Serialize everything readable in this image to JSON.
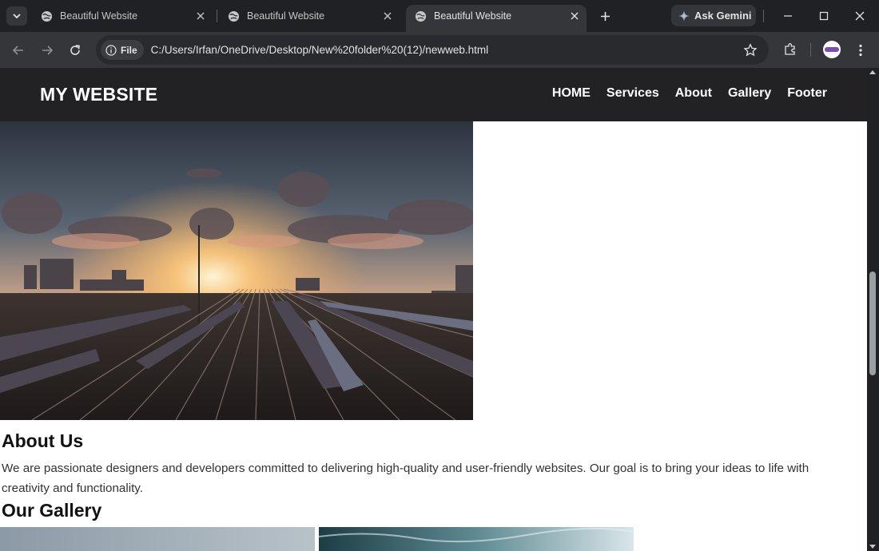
{
  "browser": {
    "tabs": [
      {
        "title": "Beautiful Website",
        "favicon": "globe-icon"
      },
      {
        "title": "Beautiful Website",
        "favicon": "globe-icon"
      },
      {
        "title": "Beautiful Website",
        "favicon": "globe-icon",
        "active": true
      }
    ],
    "gemini_label": "Ask Gemini",
    "chip_label": "File",
    "url": "C:/Users/Irfan/OneDrive/Desktop/New%20folder%20(12)/newweb.html"
  },
  "site": {
    "logo": "MY WEBSITE",
    "nav": [
      "HOME",
      "Services",
      "About",
      "Gallery",
      "Footer"
    ],
    "about": {
      "title": "About Us",
      "text": "We are passionate designers and developers committed to delivering high-quality and user-friendly websites. Our goal is to bring your ideas to life with creativity and functionality."
    },
    "gallery": {
      "title": "Our Gallery"
    }
  },
  "colors": {
    "chrome_bg": "#202124",
    "toolbar_bg": "#35363a",
    "site_header_bg": "#222224",
    "page_bg": "#ffffff"
  }
}
